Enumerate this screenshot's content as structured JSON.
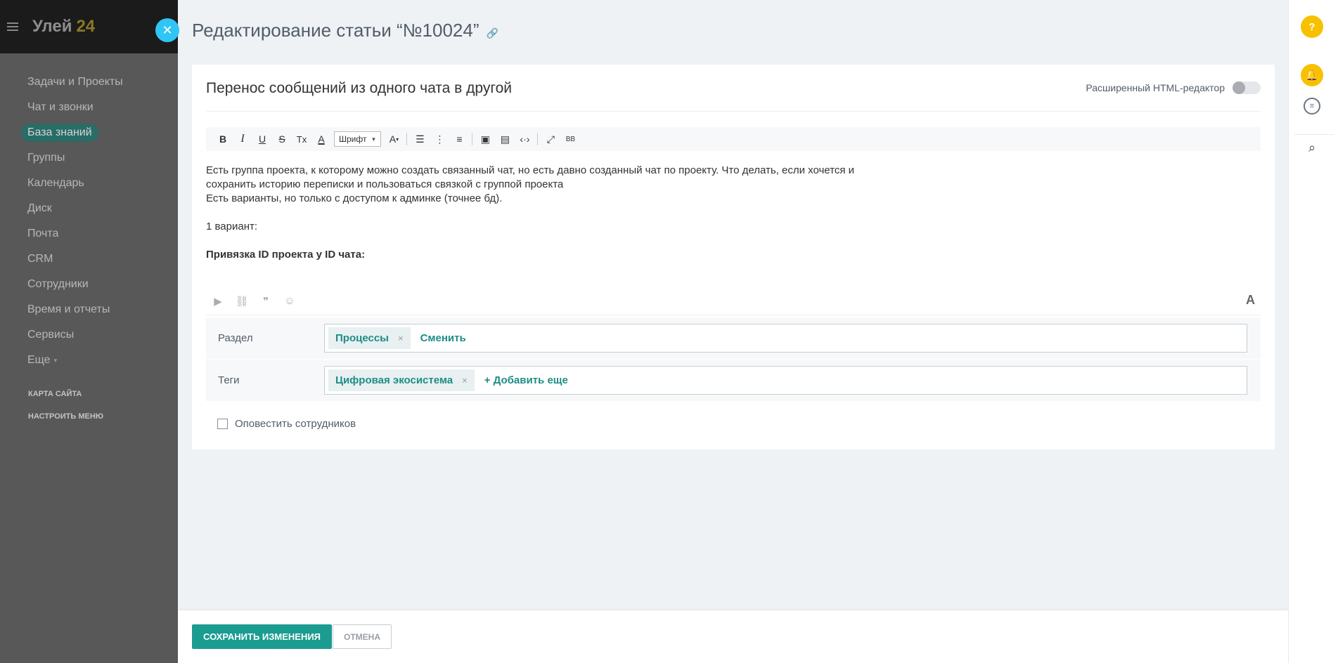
{
  "sidebar": {
    "logo_text": "Улей",
    "logo_num": "24",
    "items": [
      {
        "label": "Задачи и Проекты"
      },
      {
        "label": "Чат и звонки"
      },
      {
        "label": "База знаний",
        "active": true
      },
      {
        "label": "Группы"
      },
      {
        "label": "Календарь"
      },
      {
        "label": "Диск"
      },
      {
        "label": "Почта"
      },
      {
        "label": "CRM"
      },
      {
        "label": "Сотрудники"
      },
      {
        "label": "Время и отчеты"
      },
      {
        "label": "Сервисы"
      },
      {
        "label": "Еще"
      }
    ],
    "sitemap": "КАРТА САЙТА",
    "configure_menu": "НАСТРОИТЬ МЕНЮ"
  },
  "page": {
    "title": "Редактирование статьи “№10024”"
  },
  "article": {
    "title": "Перенос сообщений из одного чата в другой",
    "html_editor_label": "Расширенный HTML-редактор",
    "html_editor_on": false
  },
  "toolbar": {
    "bold": "B",
    "italic": "I",
    "underline": "U",
    "strike": "S",
    "clear": "Tx",
    "color": "A",
    "font_label": "Шрифт",
    "font_size": "A",
    "bb": "BB"
  },
  "editor": {
    "line1": "Есть группа проекта, к которому можно создать связанный чат, но есть давно созданный чат по проекту. Что делать, если хочется и",
    "line2": "сохранить историю переписки и пользоваться связкой с группой проекта",
    "line3": "Есть варианты, но только с доступом к админке (точнее бд).",
    "line4": "1 вариант:",
    "line5": "Привязка ID проекта у ID чата:"
  },
  "fields": {
    "section_label": "Раздел",
    "section_tag": "Процессы",
    "section_change": "Сменить",
    "tags_label": "Теги",
    "tag_value": "Цифровая экосистема",
    "tag_add": "+ Добавить еще"
  },
  "notify_label": "Оповестить сотрудников",
  "footer": {
    "save": "СОХРАНИТЬ ИЗМЕНЕНИЯ",
    "cancel": "ОТМЕНА"
  },
  "right_panel": {
    "help": "?"
  },
  "colors": {
    "accent": "#1b9c90",
    "close_button": "#2fc6f6",
    "notify_yellow": "#f8c100",
    "active_menu": "#2a6c66"
  },
  "icons": [
    "menu-icon",
    "close-icon",
    "link-icon",
    "help-icon",
    "bell-icon",
    "chat-icon",
    "search-icon",
    "image-icon",
    "table-icon",
    "code-icon",
    "fullscreen-icon",
    "list-ordered-icon",
    "list-bulleted-icon",
    "align-icon",
    "video-icon",
    "quote-icon",
    "mention-icon"
  ]
}
